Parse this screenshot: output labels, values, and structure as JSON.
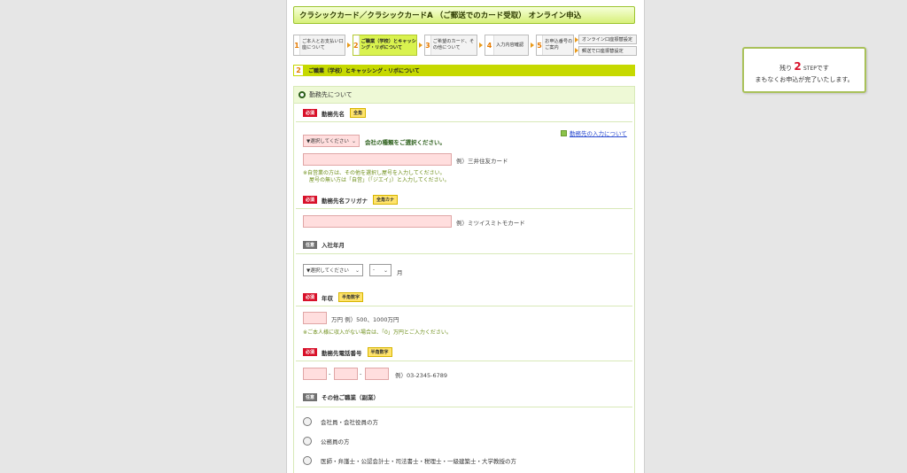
{
  "header": {
    "title": "クラシックカード／クラシックカードA （ご郵送でのカード受取） オンライン申込"
  },
  "steps": [
    {
      "num": "1",
      "label": "ご本人とお支払い口座について"
    },
    {
      "num": "2",
      "label": "ご職業（学校）とキャッシング・リボについて"
    },
    {
      "num": "3",
      "label": "ご希望のカード、その他について"
    },
    {
      "num": "4",
      "label": "入力内容確認"
    },
    {
      "num": "5",
      "label": "お申込番号のご案内"
    }
  ],
  "step_sub_options": [
    "オンライン口座振替設定",
    "郵送で口座振替設定"
  ],
  "section": {
    "num": "2",
    "title": "ご職業（学校）とキャッシング・リボについて"
  },
  "form": {
    "group_title": "勤務先について",
    "required_badge": "必須",
    "optional_badge": "任意",
    "help_link": "勤務先の入力について",
    "company_name": {
      "label": "勤務先名",
      "type_badge": "全角",
      "select_value": "▼選択してください",
      "select_prompt": "会社の種類をご選択ください。",
      "example": "例）三井住友カード",
      "note_1": "※自営業の方は、その他を選択し屋号を入力してください。",
      "note_2": "屋号の無い方は「自営」（「ジエイ」）と入力してください。"
    },
    "company_kana": {
      "label": "勤務先名フリガナ",
      "type_badge": "全角カナ",
      "example": "例）ミツイスミトモカード"
    },
    "join_date": {
      "label": "入社年月",
      "year_select": "▼選択してください",
      "month_select": "-",
      "month_unit": "月"
    },
    "income": {
      "label": "年収",
      "type_badge": "半角数字",
      "unit_example": "万円 例）500、1000万円",
      "note": "※ご本人様に収入がない場合は、「0」万円とご入力ください。"
    },
    "phone": {
      "label": "勤務先電話番号",
      "type_badge": "半角数字",
      "separator": "-",
      "example": "例）03-2345-6789"
    },
    "other_job": {
      "label": "その他ご職業（副業）",
      "options": [
        "会社員・会社役員の方",
        "公務員の方",
        "医師・弁護士・公認会計士・司法書士・税理士・一級建築士・大学教授の方"
      ]
    }
  },
  "side_panel": {
    "prefix": "残り",
    "count": "2",
    "step_word": "STEP",
    "suffix": "です",
    "message": "まもなくお申込が完了いたします。"
  }
}
